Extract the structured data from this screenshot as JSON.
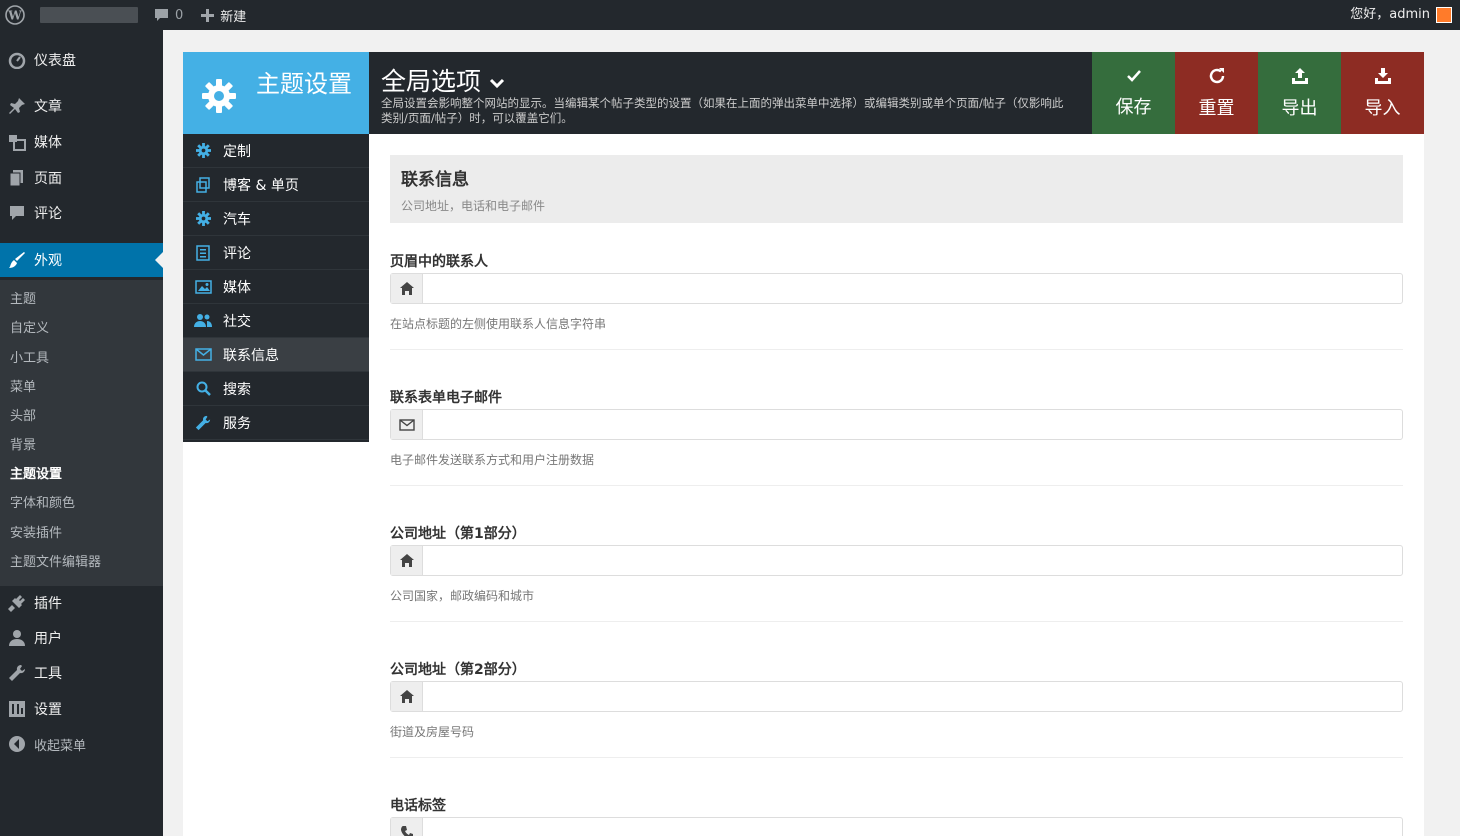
{
  "adminbar": {
    "comments_count": "0",
    "new_label": "新建",
    "howdy": "您好，admin"
  },
  "adminmenu": {
    "items": [
      {
        "label": "仪表盘",
        "icon": "dashboard-icon"
      },
      {
        "label": "文章",
        "icon": "pin-icon"
      },
      {
        "label": "媒体",
        "icon": "media-icon"
      },
      {
        "label": "页面",
        "icon": "page-icon"
      },
      {
        "label": "评论",
        "icon": "comment-icon"
      },
      {
        "label": "外观",
        "icon": "brush-icon"
      },
      {
        "label": "插件",
        "icon": "plugin-icon"
      },
      {
        "label": "用户",
        "icon": "user-icon"
      },
      {
        "label": "工具",
        "icon": "wrench-icon"
      },
      {
        "label": "设置",
        "icon": "settings-icon"
      },
      {
        "label": "收起菜单",
        "icon": "collapse-icon"
      }
    ],
    "submenu": [
      "主题",
      "自定义",
      "小工具",
      "菜单",
      "头部",
      "背景",
      "主题设置",
      "字体和颜色",
      "安装插件",
      "主题文件编辑器"
    ]
  },
  "panel": {
    "brand_title": "主题设置",
    "section_title": "全局选项",
    "section_desc": "全局设置会影响整个网站的显示。当编辑某个帖子类型的设置（如果在上面的弹出菜单中选择）或编辑类别或单个页面/帖子（仅影响此类别/页面/帖子）时，可以覆盖它们。",
    "buttons": {
      "save": "保存",
      "reset": "重置",
      "export": "导出",
      "import": "导入"
    },
    "nav": [
      {
        "label": "定制",
        "icon": "gear-icon"
      },
      {
        "label": "博客 & 单页",
        "icon": "copy-icon"
      },
      {
        "label": "汽车",
        "icon": "gear-icon"
      },
      {
        "label": "评论",
        "icon": "document-icon"
      },
      {
        "label": "媒体",
        "icon": "image-icon"
      },
      {
        "label": "社交",
        "icon": "users-icon"
      },
      {
        "label": "联系信息",
        "icon": "envelope-icon"
      },
      {
        "label": "搜索",
        "icon": "search-icon"
      },
      {
        "label": "服务",
        "icon": "wrench-icon"
      }
    ]
  },
  "content": {
    "heading": "联系信息",
    "subheading": "公司地址，电话和电子邮件",
    "fields": [
      {
        "label": "页眉中的联系人",
        "help": "在站点标题的左侧使用联系人信息字符串",
        "value": "",
        "icon": "home-icon"
      },
      {
        "label": "联系表单电子邮件",
        "help": "电子邮件发送联系方式和用户注册数据",
        "value": "",
        "icon": "envelope-icon"
      },
      {
        "label": "公司地址（第1部分）",
        "help": "公司国家，邮政编码和城市",
        "value": "",
        "icon": "home-icon"
      },
      {
        "label": "公司地址（第2部分）",
        "help": "街道及房屋号码",
        "value": "",
        "icon": "home-icon"
      },
      {
        "label": "电话标签",
        "help": "",
        "value": "",
        "icon": "phone-icon"
      }
    ]
  }
}
